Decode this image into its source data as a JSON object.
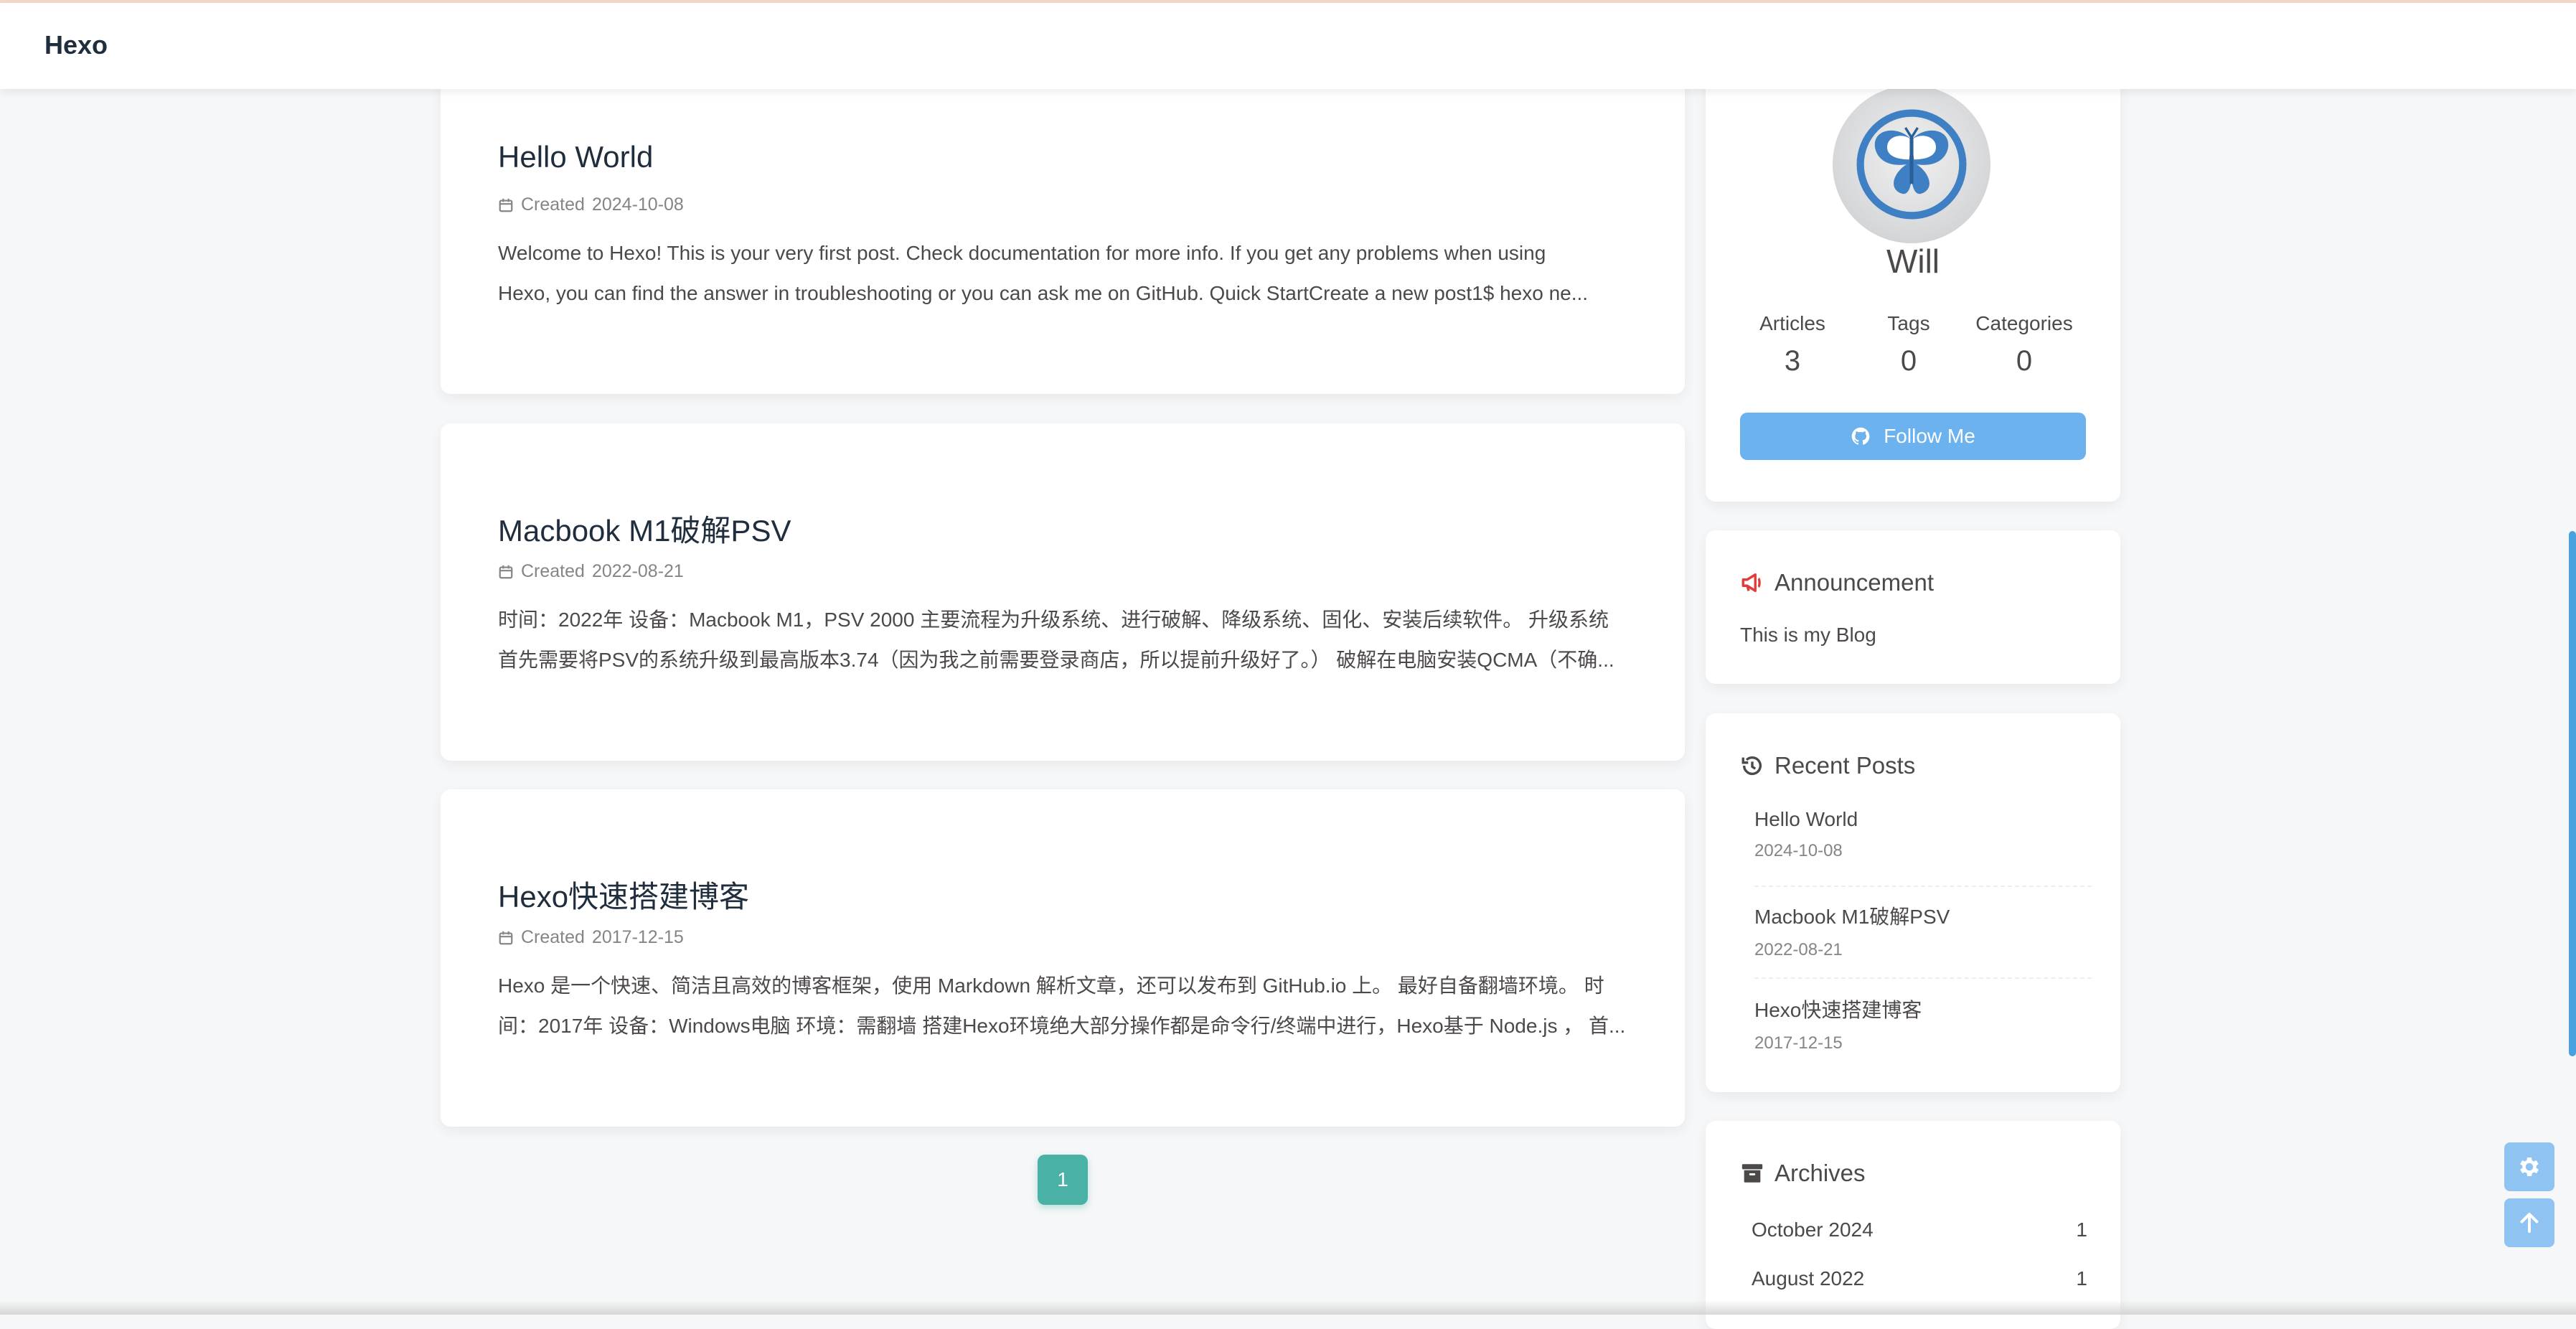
{
  "site": {
    "title": "Hexo"
  },
  "posts": [
    {
      "title": "Hello World",
      "meta_prefix": "Created",
      "date": "2024-10-08",
      "excerpt_line1": "Welcome to Hexo! This is your very first post. Check documentation for more info. If you get any problems when using",
      "excerpt_line2": "Hexo, you can find the answer in troubleshooting or you can ask me on GitHub. Quick StartCreate a new post1$ hexo ne..."
    },
    {
      "title": "Macbook M1破解PSV",
      "meta_prefix": "Created",
      "date": "2022-08-21",
      "excerpt_line1": "时间：2022年 设备：Macbook M1，PSV 2000 主要流程为升级系统、进行破解、降级系统、固化、安装后续软件。 升级系统",
      "excerpt_line2": "首先需要将PSV的系统升级到最高版本3.74（因为我之前需要登录商店，所以提前升级好了。） 破解在电脑安装QCMA（不确..."
    },
    {
      "title": "Hexo快速搭建博客",
      "meta_prefix": "Created",
      "date": "2017-12-15",
      "excerpt_line1": "Hexo 是一个快速、简洁且高效的博客框架，使用 Markdown 解析文章，还可以发布到 GitHub.io 上。 最好自备翻墙环境。 时",
      "excerpt_line2": "间：2017年 设备：Windows电脑 环境：需翻墙 搭建Hexo环境绝大部分操作都是命令行/终端中进行，Hexo基于 Node.js ， 首..."
    }
  ],
  "pagination": {
    "current": "1"
  },
  "author": {
    "name": "Will",
    "stats": [
      {
        "label": "Articles",
        "value": "3"
      },
      {
        "label": "Tags",
        "value": "0"
      },
      {
        "label": "Categories",
        "value": "0"
      }
    ],
    "follow_label": "Follow Me"
  },
  "announcement": {
    "heading": "Announcement",
    "text": "This is my Blog"
  },
  "recent_posts": {
    "heading": "Recent Posts",
    "items": [
      {
        "title": "Hello World",
        "date": "2024-10-08"
      },
      {
        "title": "Macbook M1破解PSV",
        "date": "2022-08-21"
      },
      {
        "title": "Hexo快速搭建博客",
        "date": "2017-12-15"
      }
    ]
  },
  "archives": {
    "heading": "Archives",
    "items": [
      {
        "label": "October 2024",
        "count": "1"
      },
      {
        "label": "August 2022",
        "count": "1"
      }
    ]
  },
  "icons": {
    "calendar": "calendar-icon",
    "github": "github-icon",
    "announcement": "bullhorn-icon",
    "recent": "history-icon",
    "archives": "archive-icon",
    "settings": "gear-icon",
    "back_to_top": "arrow-up-icon"
  },
  "colors": {
    "accent": "#49b1a5",
    "button": "#6cb2ee",
    "float_button": "#8fc4f2"
  }
}
